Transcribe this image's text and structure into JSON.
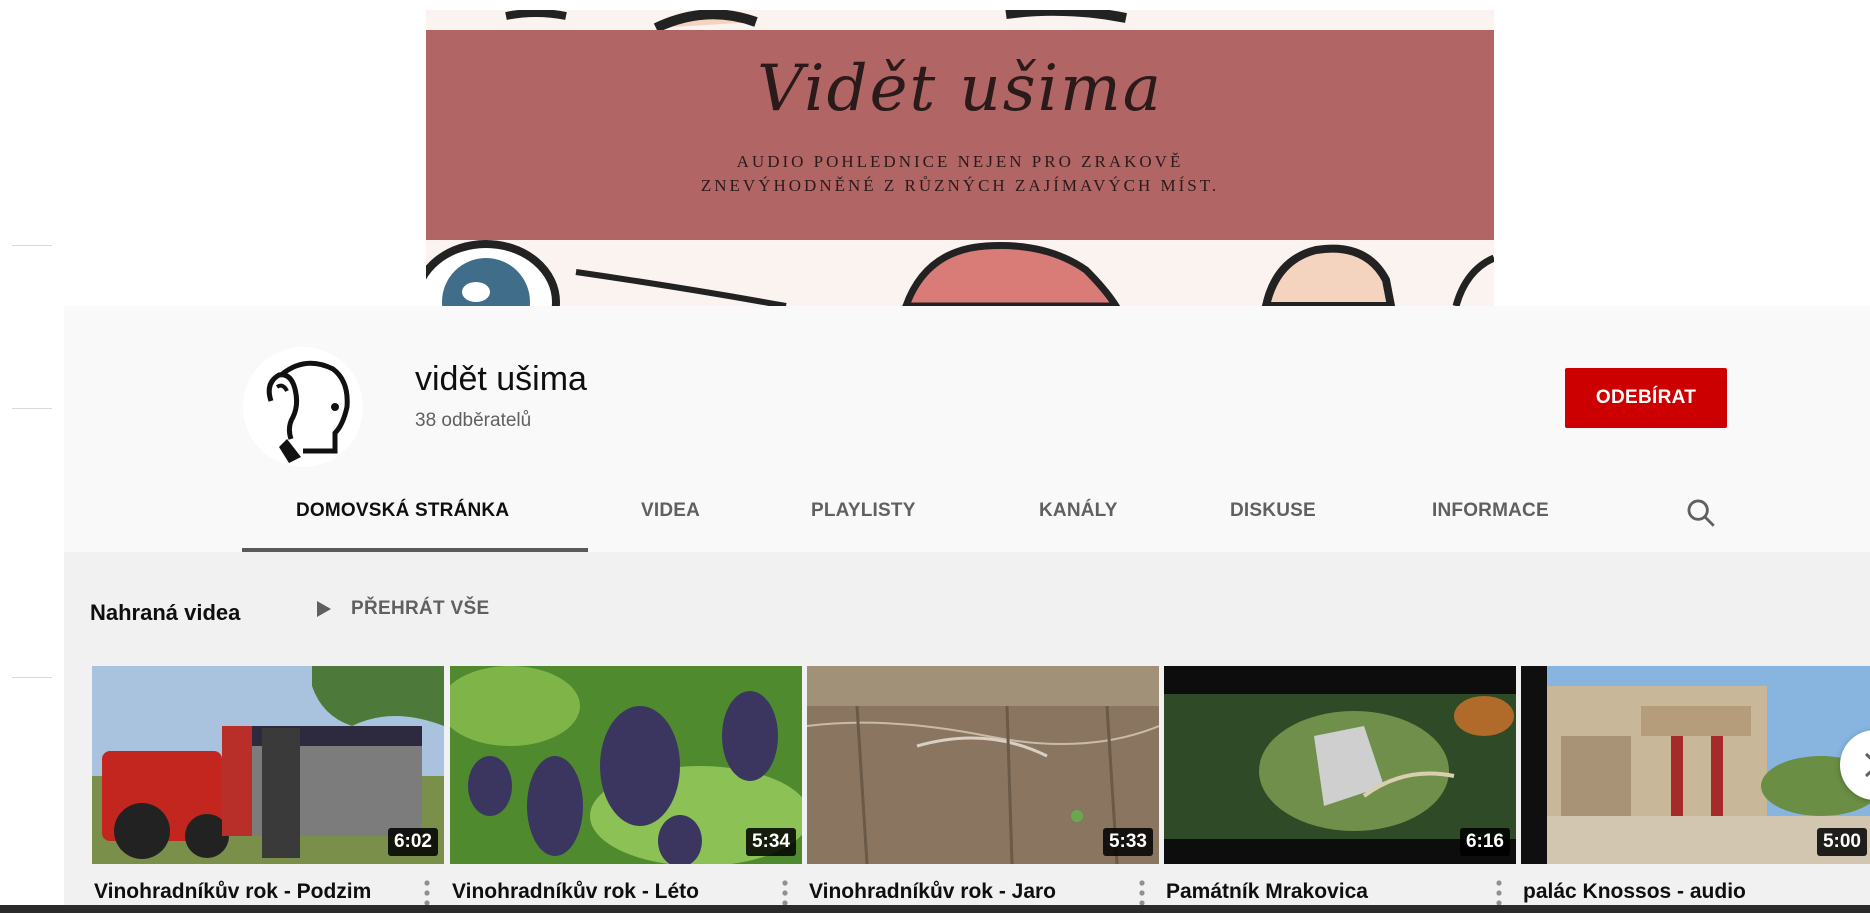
{
  "banner": {
    "script_title": "Vidět ušima",
    "subtitle_line1": "AUDIO POHLEDNICE NEJEN PRO ZRAKOVĚ",
    "subtitle_line2": "ZNEVÝHODNĚNÉ Z RŮZNÝCH ZAJÍMAVÝCH MÍST."
  },
  "channel": {
    "name": "vidět ušima",
    "subscribers": "38 odběratelů",
    "subscribe_label": "ODEBÍRAT"
  },
  "tabs": [
    {
      "label": "DOMOVSKÁ STRÁNKA",
      "active": true
    },
    {
      "label": "VIDEA"
    },
    {
      "label": "PLAYLISTY"
    },
    {
      "label": "KANÁLY"
    },
    {
      "label": "DISKUSE"
    },
    {
      "label": "INFORMACE"
    }
  ],
  "section": {
    "title": "Nahraná videa",
    "play_all_label": "PŘEHRÁT VŠE"
  },
  "videos": [
    {
      "title": "Vinohradníkův rok - Podzim",
      "duration": "6:02"
    },
    {
      "title": "Vinohradníkův rok - Léto",
      "duration": "5:34"
    },
    {
      "title": "Vinohradníkův rok - Jaro",
      "duration": "5:33"
    },
    {
      "title": "Památník Mrakovica",
      "duration": "6:16"
    },
    {
      "title": "palác Knossos - audio",
      "duration": "5:00"
    }
  ],
  "colors": {
    "subscribe": "#cc0000",
    "banner_band": "#b26565",
    "header_bg": "#f9f9f9",
    "content_bg": "#f1f1f1"
  }
}
